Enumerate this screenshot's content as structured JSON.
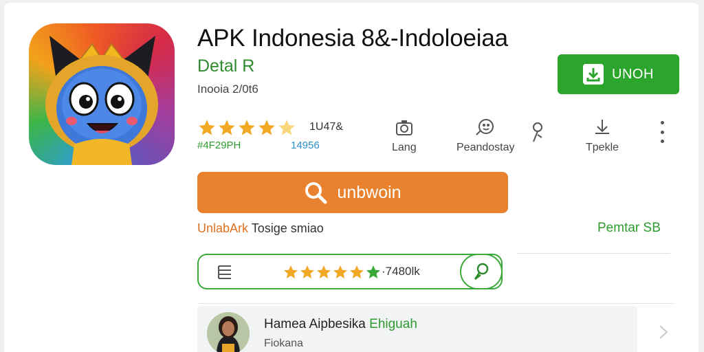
{
  "app": {
    "title": "APK Indonesia 8&-Indoloeiaa",
    "subtitle": "Detal R",
    "meta": "Inooia 2/0t6"
  },
  "install_button": {
    "label": "UNOH",
    "icon": "download-icon"
  },
  "rating": {
    "stars": 4.5,
    "count": "1U47&",
    "sub_left": "#4F29PH",
    "sub_right": "14956"
  },
  "info_items": [
    {
      "label": "Lang",
      "icon": "camera-icon"
    },
    {
      "label": "Peandostay",
      "icon": "people-icon"
    },
    {
      "label": "Tpekle",
      "icon": "download-arrow-icon"
    }
  ],
  "search_button": {
    "label": "unbwoin",
    "icon": "search-icon"
  },
  "links": {
    "left_orange": "UnlabArk",
    "left_gray": "Tosige smiao",
    "right": "Pemtar SB"
  },
  "rating_bar": {
    "stars": 5,
    "count": "·7480lk"
  },
  "review": {
    "name": "Hamea Aipbesika",
    "name_green": "Ehiguah",
    "sub": "Fiokana"
  },
  "colors": {
    "green": "#2ca52c",
    "orange": "#e9822e",
    "star": "#f1a824"
  }
}
